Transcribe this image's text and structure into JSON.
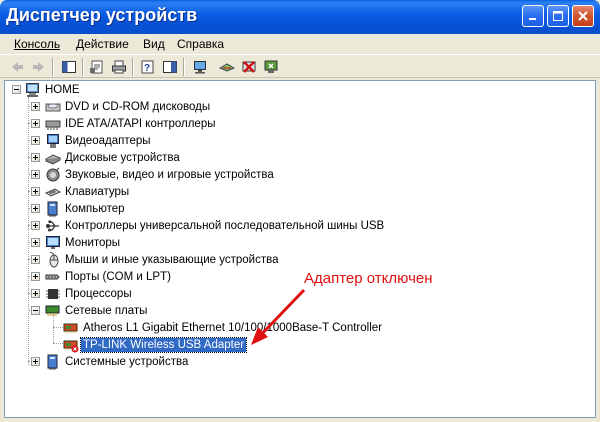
{
  "window": {
    "title": "Диспетчер устройств",
    "controls": [
      "minimize",
      "maximize",
      "close"
    ]
  },
  "menu": [
    {
      "label": "Консоль",
      "accel_index": 0
    },
    {
      "label": "Действие",
      "accel_index": 0
    },
    {
      "label": "Вид",
      "accel_index": 0
    },
    {
      "label": "Справка",
      "accel_index": 0
    }
  ],
  "toolbar": {
    "icons": [
      "back-icon",
      "forward-icon",
      "show-hide-tree-icon",
      "properties-icon",
      "print-icon",
      "help-icon",
      "console-tree-icon",
      "scan-hardware-icon",
      "update-driver-icon",
      "uninstall-icon",
      "disable-icon"
    ]
  },
  "tree": {
    "root": "HOME",
    "items": [
      {
        "label": "DVD и CD-ROM дисководы",
        "icon": "cdrom-icon",
        "expandable": true
      },
      {
        "label": "IDE ATA/ATAPI контроллеры",
        "icon": "ide-controller-icon",
        "expandable": true
      },
      {
        "label": "Видеоадаптеры",
        "icon": "display-adapter-icon",
        "expandable": true
      },
      {
        "label": "Дисковые устройства",
        "icon": "disk-drive-icon",
        "expandable": true
      },
      {
        "label": "Звуковые, видео и игровые устройства",
        "icon": "sound-icon",
        "expandable": true
      },
      {
        "label": "Клавиатуры",
        "icon": "keyboard-icon",
        "expandable": true
      },
      {
        "label": "Компьютер",
        "icon": "computer-icon",
        "expandable": true
      },
      {
        "label": "Контроллеры универсальной последовательной шины USB",
        "icon": "usb-icon",
        "expandable": true
      },
      {
        "label": "Мониторы",
        "icon": "monitor-icon",
        "expandable": true
      },
      {
        "label": "Мыши и иные указывающие устройства",
        "icon": "mouse-icon",
        "expandable": true
      },
      {
        "label": "Порты (COM и LPT)",
        "icon": "port-icon",
        "expandable": true
      },
      {
        "label": "Процессоры",
        "icon": "processor-icon",
        "expandable": true
      },
      {
        "label": "Сетевые платы",
        "icon": "network-adapter-icon",
        "expandable": true,
        "expanded": true,
        "children": [
          {
            "label": "Atheros L1 Gigabit Ethernet 10/100/1000Base-T Controller",
            "icon": "network-card-icon"
          },
          {
            "label": "TP-LINK Wireless USB Adapter",
            "icon": "network-card-disabled-icon",
            "selected": true,
            "disabled": true
          }
        ]
      },
      {
        "label": "Системные устройства",
        "icon": "system-device-icon",
        "expandable": true
      }
    ]
  },
  "annotation": {
    "text": "Адаптер отключен",
    "color": "#e01010"
  },
  "colors": {
    "title_bar": "#0752d6",
    "selection": "#316ac5",
    "window_bg": "#ece9d8"
  }
}
